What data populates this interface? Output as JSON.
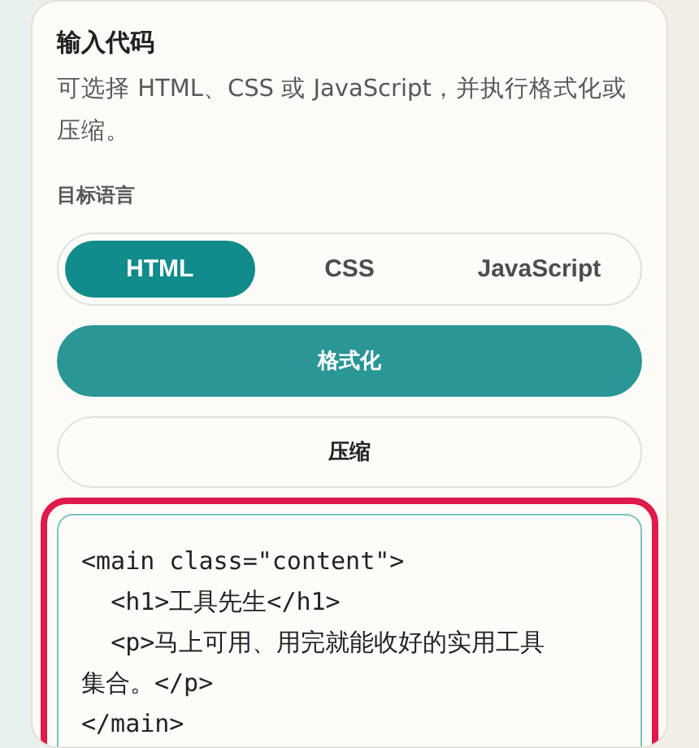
{
  "card": {
    "title": "输入代码",
    "description": "可选择 HTML、CSS 或 JavaScript，并执行格式化或压缩。"
  },
  "language": {
    "label": "目标语言",
    "options": [
      {
        "label": "HTML",
        "selected": true
      },
      {
        "label": "CSS",
        "selected": false
      },
      {
        "label": "JavaScript",
        "selected": false
      }
    ]
  },
  "actions": [
    {
      "label": "格式化",
      "kind": "primary"
    },
    {
      "label": "压缩",
      "kind": "secondary"
    }
  ],
  "code_input": {
    "highlighted": true,
    "value": "<main class=\"content\">\n  <h1>工具先生</h1>\n  <p>马上可用、用完就能收好的实用工具集合。</p>\n</main>"
  }
}
